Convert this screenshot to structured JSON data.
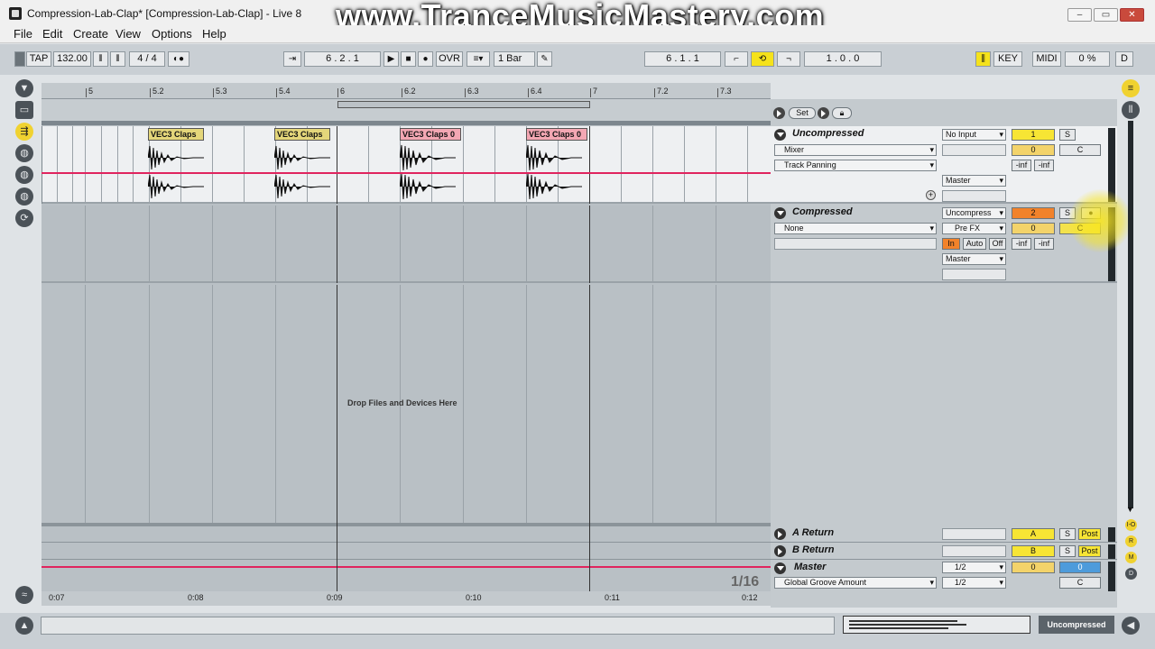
{
  "window": {
    "title": "Compression-Lab-Clap*  [Compression-Lab-Clap] - Live 8",
    "watermark": "www.TranceMusicMastery.com"
  },
  "menu": [
    "File",
    "Edit",
    "Create",
    "View",
    "Options",
    "Help"
  ],
  "transport": {
    "tap": "TAP",
    "tempo": "132.00",
    "signature": "4 / 4",
    "position": "6 .   2 .   1",
    "ovr": "OVR",
    "quantize": "1 Bar",
    "loop_start": "6 .   1 .   1",
    "loop_length": "1 .   0 .   0",
    "key": "KEY",
    "midi": "MIDI",
    "cpu": "0 %",
    "d": "D"
  },
  "ruler": {
    "marks": [
      "5",
      "5.2",
      "5.3",
      "5.4",
      "6",
      "6.2",
      "6.3",
      "6.4",
      "7",
      "7.2",
      "7.3"
    ]
  },
  "clips": [
    {
      "name": "VEC3 Claps",
      "color": "yellow"
    },
    {
      "name": "VEC3 Claps",
      "color": "yellow"
    },
    {
      "name": "VEC3 Claps 0",
      "color": "pink"
    },
    {
      "name": "VEC3 Claps 0",
      "color": "pink"
    }
  ],
  "drop_text": "Drop Files and Devices Here",
  "zoom_label": "1/16",
  "time_marks": [
    "0:07",
    "0:08",
    "0:09",
    "0:10",
    "0:11",
    "0:12"
  ],
  "headers": {
    "set_label": "Set",
    "track1": {
      "name": "Uncompressed",
      "device": "Mixer",
      "param": "Track Panning",
      "input": "No Input",
      "output": "Master",
      "number": "1",
      "solo": "S",
      "volume": "0",
      "pan": "C",
      "peak_l": "-inf",
      "peak_r": "-inf"
    },
    "track2": {
      "name": "Compressed",
      "device": "None",
      "input": "Uncompress",
      "input_channel": "Pre FX",
      "monitor_in": "In",
      "monitor_auto": "Auto",
      "monitor_off": "Off",
      "output": "Master",
      "number": "2",
      "solo": "S",
      "volume": "0",
      "pan": "C",
      "peak_l": "-inf",
      "peak_r": "-inf"
    },
    "return_a": {
      "name": "A Return",
      "letter": "A",
      "solo": "S",
      "post": "Post"
    },
    "return_b": {
      "name": "B Return",
      "letter": "B",
      "solo": "S",
      "post": "Post"
    },
    "master": {
      "name": "Master",
      "groove": "Global Groove Amount",
      "out1": "1/2",
      "out2": "1/2",
      "volume": "0",
      "cue": "0",
      "pan": "C"
    }
  },
  "status": {
    "selected_track": "Uncompressed"
  },
  "colors": {
    "clip_yellow": "#e4d67a",
    "clip_pink": "#f3a7b3",
    "track_yellow": "#f7e534",
    "track_orange": "#f2822a",
    "playhead_red": "#e0245e"
  }
}
